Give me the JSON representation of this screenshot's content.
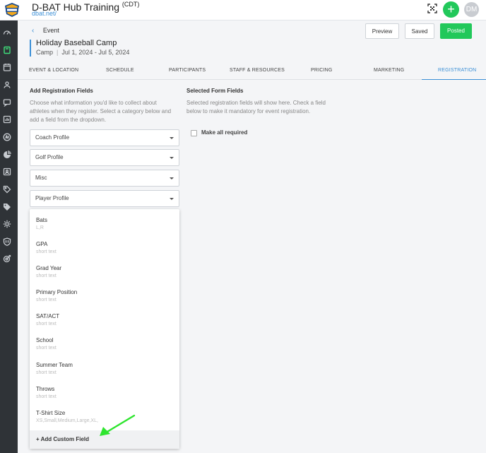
{
  "header": {
    "app_title": "D-BAT Hub Training",
    "timezone": "(CDT)",
    "app_url": "dbat.net/",
    "add_label": "+",
    "avatar_initials": "DM"
  },
  "sidebar": {
    "icons": [
      "dashboard-icon",
      "book-icon",
      "calendar-dollar-icon",
      "users-icon",
      "chat-icon",
      "chart-icon",
      "ai-icon",
      "pie-icon",
      "id-card-icon",
      "tag-icon",
      "tags-icon",
      "gear-icon",
      "shield-icon",
      "target-icon"
    ],
    "active_index": 1
  },
  "event": {
    "back_label": "Event",
    "title": "Holiday Baseball Camp",
    "type": "Camp",
    "dates": "Jul 1, 2024 - Jul 5, 2024"
  },
  "actions": {
    "preview_label": "Preview",
    "saved_label": "Saved",
    "posted_label": "Posted"
  },
  "tabs": [
    {
      "label": "EVENT & LOCATION"
    },
    {
      "label": "SCHEDULE"
    },
    {
      "label": "PARTICIPANTS"
    },
    {
      "label": "STAFF & RESOURCES"
    },
    {
      "label": "PRICING"
    },
    {
      "label": "MARKETING"
    },
    {
      "label": "REGISTRATION"
    }
  ],
  "active_tab": "REGISTRATION",
  "add_fields": {
    "title": "Add Registration Fields",
    "description": "Choose what information you'd like to collect about athletes when they register. Select a category below and add a field from the dropdown.",
    "dropdowns": [
      {
        "label": "Coach Profile"
      },
      {
        "label": "Golf Profile"
      },
      {
        "label": "Misc"
      },
      {
        "label": "Player Profile"
      }
    ],
    "menu_items": [
      {
        "label": "Bats",
        "type": "L,R"
      },
      {
        "label": "GPA",
        "type": "short text"
      },
      {
        "label": "Grad Year",
        "type": "short text"
      },
      {
        "label": "Primary Position",
        "type": "short text"
      },
      {
        "label": "SAT/ACT",
        "type": "short text"
      },
      {
        "label": "School",
        "type": "short text"
      },
      {
        "label": "Summer Team",
        "type": "short text"
      },
      {
        "label": "Throws",
        "type": "short text"
      },
      {
        "label": "T-Shirt Size",
        "type": "XS,Small,Medium,Large,XL,"
      }
    ],
    "add_custom_label": "+ Add Custom Field"
  },
  "selected_fields": {
    "title": "Selected Form Fields",
    "description": "Selected registration fields will show here. Check a field below to make it mandatory for event registration.",
    "make_all_required_label": "Make all required"
  },
  "colors": {
    "accent_blue": "#3b8fd6",
    "success_green": "#21c85a",
    "sidebar_dark": "#2f3337",
    "annotation_arrow": "#2ee52e"
  }
}
